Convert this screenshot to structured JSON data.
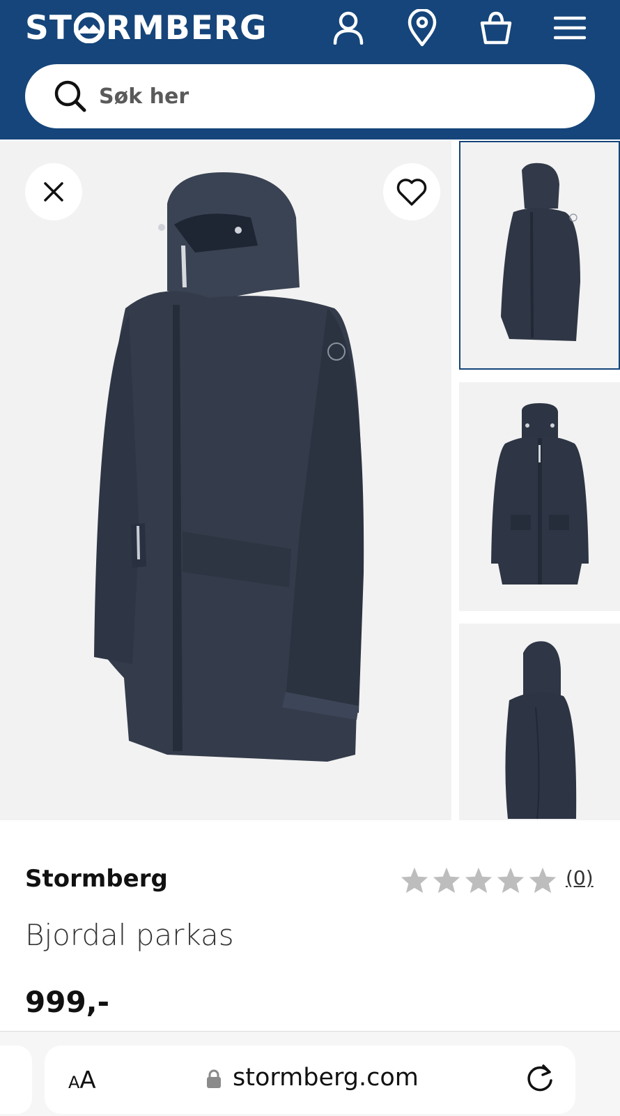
{
  "header": {
    "logo": {
      "before": "ST",
      "after": "RMBERG"
    },
    "icons": [
      "user-icon",
      "location-pin-icon",
      "shopping-bag-icon",
      "menu-icon"
    ],
    "background": "#15457a"
  },
  "search": {
    "placeholder": "Søk her"
  },
  "gallery": {
    "main_image": "navy hooded parka, three-quarter front view",
    "thumbnails": [
      "parka side-front view",
      "parka front view",
      "parka back view"
    ],
    "selected_thumbnail": 1
  },
  "product": {
    "brand": "Stormberg",
    "name": "Bjordal parkas",
    "price": "999,-",
    "rating": {
      "stars": 0,
      "max": 5,
      "count": "(0)"
    }
  },
  "browser": {
    "text_size_label": "AA",
    "url": "stormberg.com"
  }
}
